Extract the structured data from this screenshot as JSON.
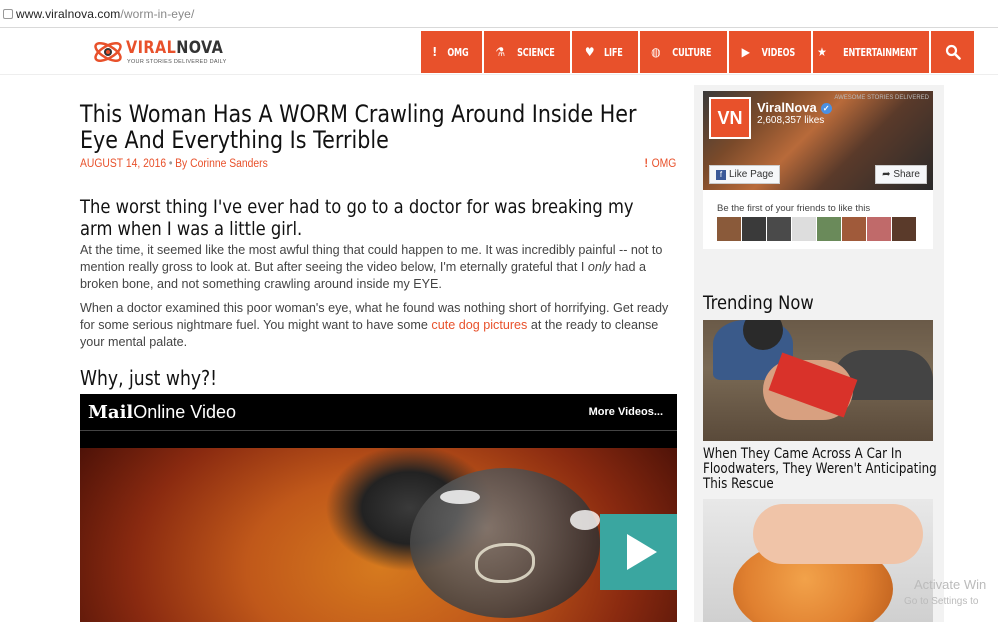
{
  "browser": {
    "url_host": "www.viralnova.com",
    "url_path": "/worm-in-eye/"
  },
  "header": {
    "brand_viral": "VIRAL",
    "brand_nova": "NOVA",
    "tagline": "YOUR STORIES DELIVERED DAILY",
    "nav": [
      {
        "label": "OMG",
        "icon": "exclamation-icon"
      },
      {
        "label": "SCIENCE",
        "icon": "flask-icon"
      },
      {
        "label": "LIFE",
        "icon": "heart-icon"
      },
      {
        "label": "CULTURE",
        "icon": "globe-icon"
      },
      {
        "label": "VIDEOS",
        "icon": "play-icon"
      },
      {
        "label": "ENTERTAINMENT",
        "icon": "star-icon"
      }
    ],
    "accent": "#e8512b"
  },
  "article": {
    "title": "This Woman Has A WORM Crawling Around Inside Her Eye And Everything Is Terrible",
    "date": "AUGUST 14, 2016",
    "author": "By Corinne Sanders",
    "category": "OMG",
    "lead": "The worst thing I've ever had to go to a doctor for was breaking my arm when I was a little girl.",
    "p1_a": "At the time, it seemed like the most awful thing that could happen to me. It was incredibly painful -- not to mention really gross to look at. But after seeing the video below, I'm eternally grateful that I ",
    "p1_em": "only",
    "p1_b": " had a broken bone, and not something crawling around inside my EYE.",
    "p2_a": "When a doctor examined this poor woman's eye, what he found was nothing short of horrifying. Get ready for some serious nightmare fuel. You might want to have some ",
    "p2_link": "cute dog pictures",
    "p2_b": " at the ready to cleanse your mental palate.",
    "subhead": "Why, just why?!"
  },
  "video": {
    "logo_mail": "Mail",
    "logo_online": "Online Video",
    "more": "More Videos..."
  },
  "facebook": {
    "avatar": "VN",
    "page_name": "ViralNova",
    "likes": "2,608,357 likes",
    "cover_text": "AWESOME STORIES DELIVERED",
    "like_button": "Like Page",
    "share_button": "Share",
    "friends_text": "Be the first of your friends to like this"
  },
  "trending": {
    "title": "Trending Now",
    "items": [
      {
        "caption": "When They Came Across A Car In Floodwaters, They Weren't Anticipating This Rescue"
      }
    ]
  },
  "os_watermark": {
    "line1": "Activate Win",
    "line2": "Go to Settings to"
  }
}
